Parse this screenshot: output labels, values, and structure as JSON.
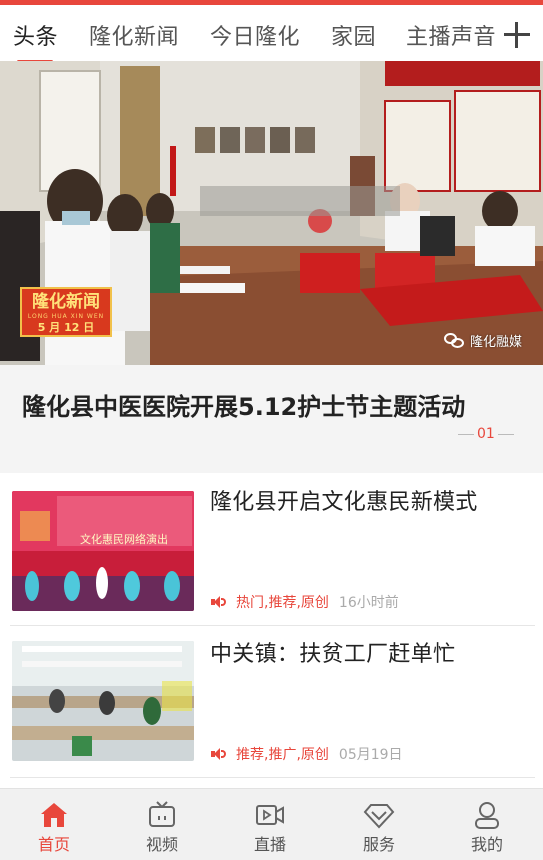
{
  "tabs": [
    {
      "label": "头条",
      "active": true
    },
    {
      "label": "隆化新闻",
      "active": false
    },
    {
      "label": "今日隆化",
      "active": false
    },
    {
      "label": "家园",
      "active": false
    },
    {
      "label": "主播声音",
      "active": false
    }
  ],
  "add_icon": "plus-icon",
  "hero": {
    "badge_title": "隆化新闻",
    "badge_pinyin": "LONG HUA XIN WEN",
    "badge_date": "5 月 12 日",
    "watermark": "隆化融媒",
    "headline": "隆化县中医医院开展5.12护士节主题活动",
    "page_indicator": "01"
  },
  "list": [
    {
      "title": "隆化县开启文化惠民新模式",
      "tags": "热门,推荐,原创",
      "time": "16小时前",
      "thumb_caption": "文化惠民网络演出"
    },
    {
      "title": "中关镇：扶贫工厂赶单忙",
      "tags": "推荐,推广,原创",
      "time": "05月19日"
    }
  ],
  "tabbar": [
    {
      "label": "首页",
      "icon": "home-icon",
      "active": true
    },
    {
      "label": "视频",
      "icon": "tv-icon",
      "active": false
    },
    {
      "label": "直播",
      "icon": "video-camera-icon",
      "active": false
    },
    {
      "label": "服务",
      "icon": "diamond-icon",
      "active": false
    },
    {
      "label": "我的",
      "icon": "user-icon",
      "active": false
    }
  ],
  "colors": {
    "accent": "#e8473c",
    "tabbar_bg": "#f1f1f1"
  }
}
